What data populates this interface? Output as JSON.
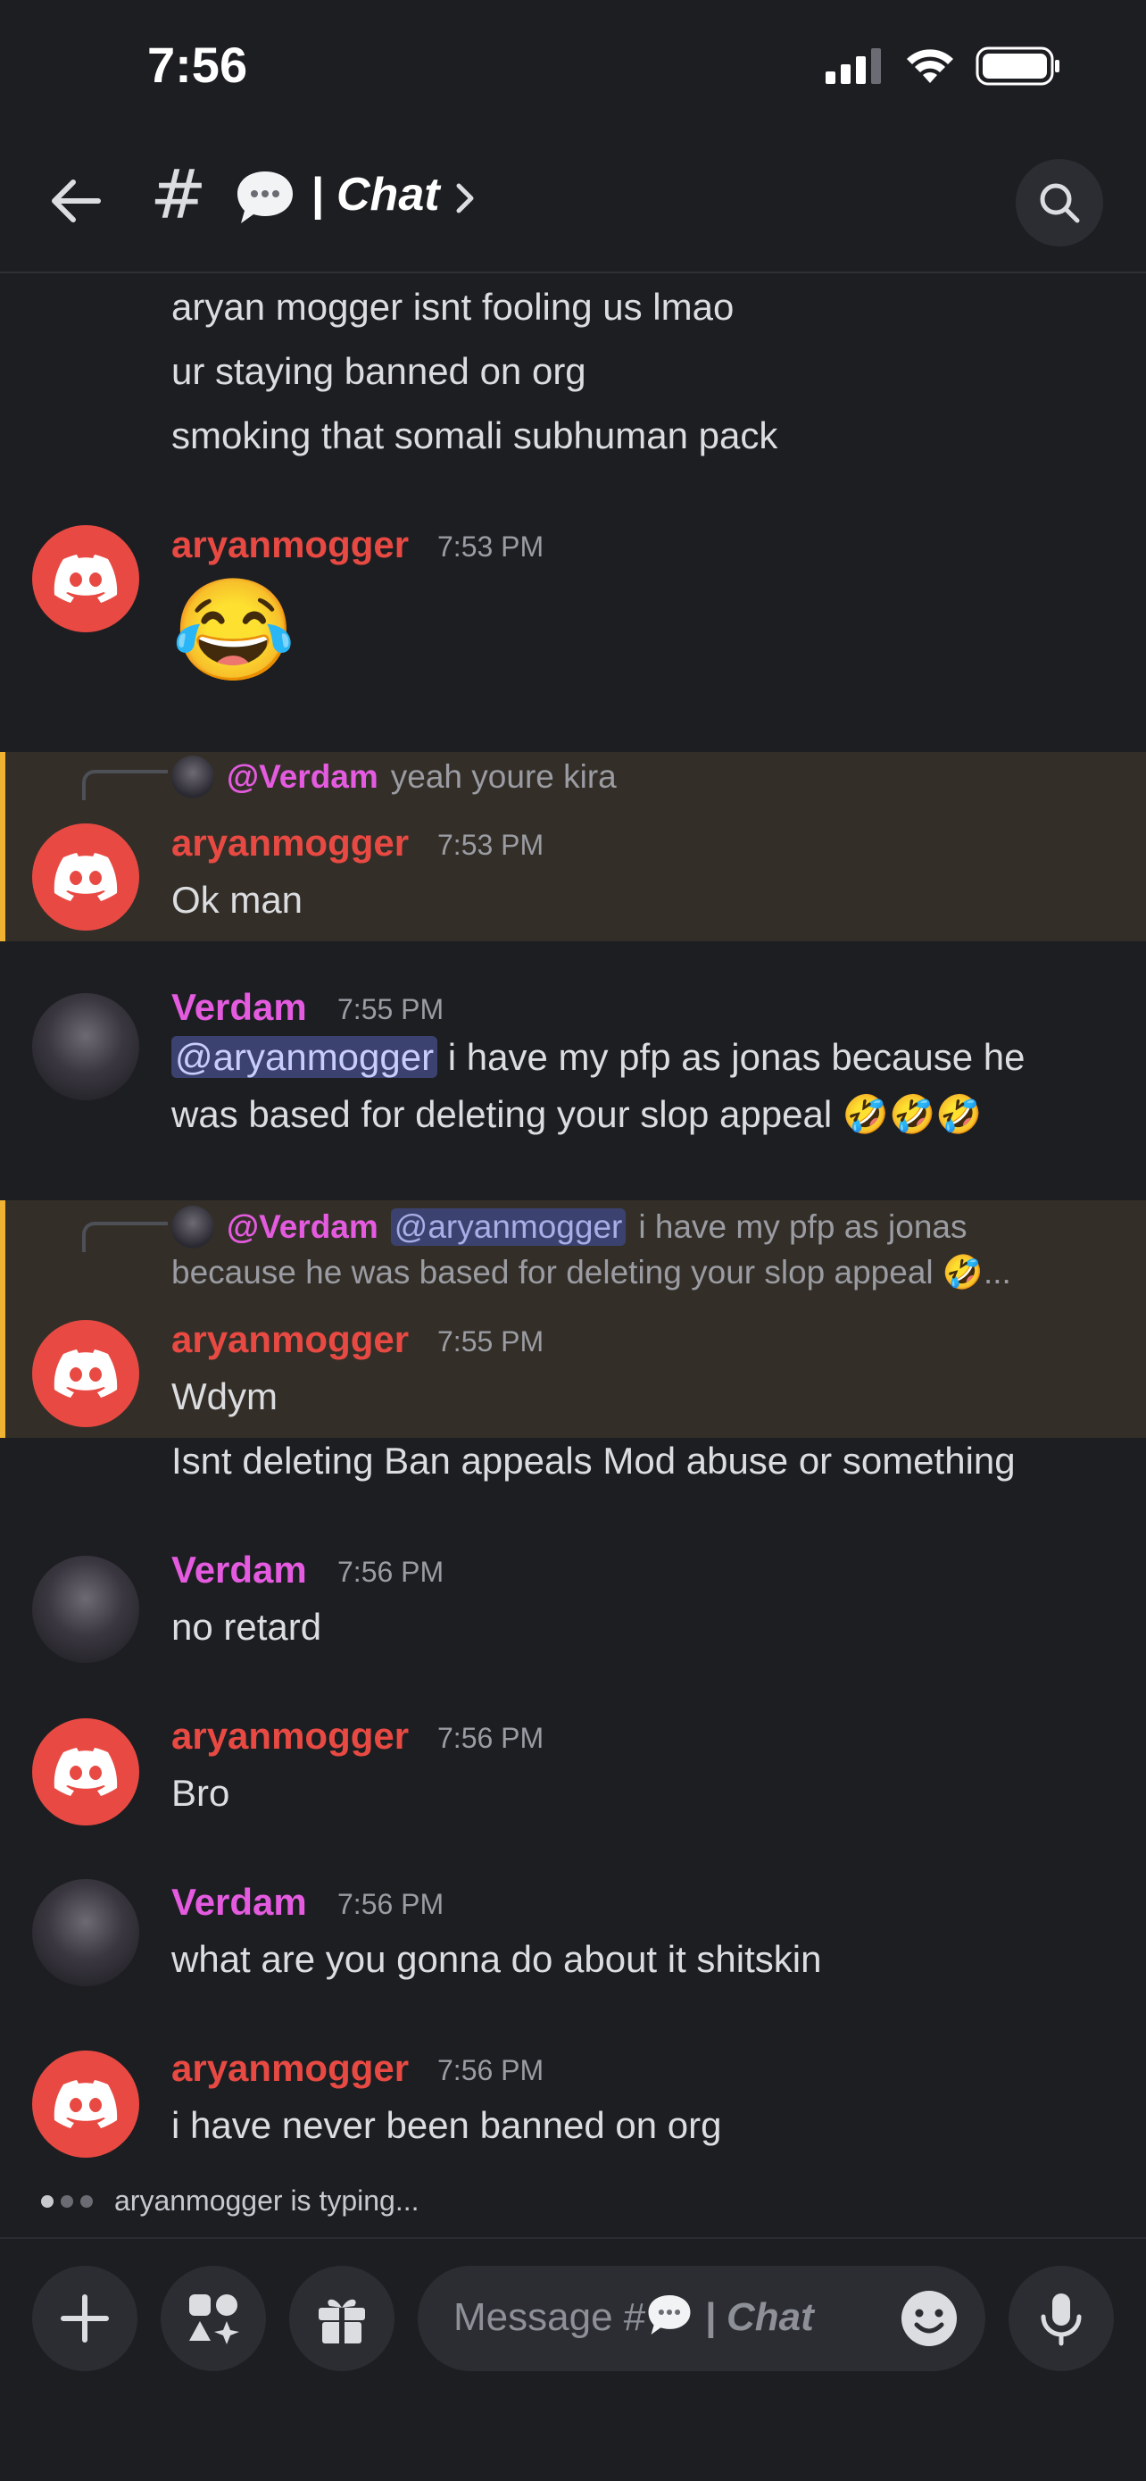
{
  "status_bar": {
    "time": "7:56"
  },
  "header": {
    "channel_hash": "#",
    "channel_name": "| Chat"
  },
  "messages": {
    "continuation": [
      "aryan mogger isnt fooling us lmao",
      "ur staying banned on org",
      "smoking that somali subhuman pack"
    ],
    "m1": {
      "author": "aryanmogger",
      "time": "7:53 PM",
      "emoji": "😂"
    },
    "m2": {
      "reply_author": "@Verdam",
      "reply_text": "yeah youre kira",
      "author": "aryanmogger",
      "time": "7:53 PM",
      "text": "Ok man"
    },
    "m3": {
      "author": "Verdam",
      "time": "7:55 PM",
      "mention": "@aryanmogger",
      "text_line1": "i have my pfp as jonas because he",
      "text_line2": "was based for deleting your slop appeal 🤣🤣🤣"
    },
    "m4": {
      "reply_author": "@Verdam",
      "reply_mention": "@aryanmogger",
      "reply_text_line1": "i have my pfp as jonas",
      "reply_text_line2": "because he was based for deleting your slop appeal 🤣...",
      "author": "aryanmogger",
      "time": "7:55 PM",
      "text_line1": "Wdym",
      "text_line2": "Isnt deleting Ban appeals Mod abuse or something"
    },
    "m5": {
      "author": "Verdam",
      "time": "7:56 PM",
      "text": "no retard"
    },
    "m6": {
      "author": "aryanmogger",
      "time": "7:56 PM",
      "text": "Bro"
    },
    "m7": {
      "author": "Verdam",
      "time": "7:56 PM",
      "text": "what are you gonna do about it shitskin"
    },
    "m8": {
      "author": "aryanmogger",
      "time": "7:56 PM",
      "text": "i have never been banned on org"
    }
  },
  "typing": {
    "text": "aryanmogger is typing..."
  },
  "composer": {
    "placeholder_prefix": "Message #",
    "placeholder_channel": "| Chat"
  },
  "colors": {
    "accent_red": "#e84a43",
    "verdam_pink": "#e45bdf",
    "highlight_bar": "#f0b232"
  }
}
